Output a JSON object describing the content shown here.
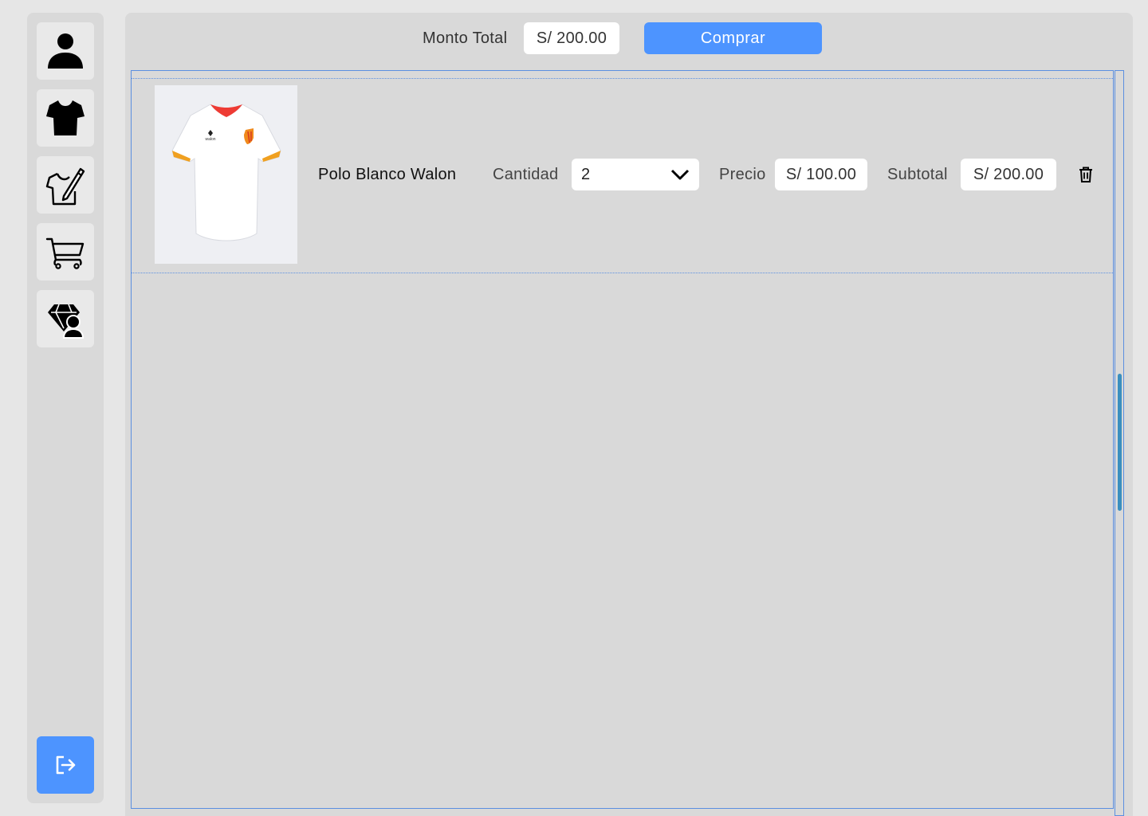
{
  "sidebar": {
    "items": [
      {
        "name": "profile",
        "icon": "user-icon"
      },
      {
        "name": "products",
        "icon": "tshirt-icon"
      },
      {
        "name": "design",
        "icon": "tshirt-pencil-icon"
      },
      {
        "name": "cart",
        "icon": "cart-icon"
      },
      {
        "name": "brand",
        "icon": "gem-user-icon"
      }
    ],
    "logout_icon": "logout-icon"
  },
  "cart": {
    "total_label": "Monto Total",
    "total_value": "S/ 200.00",
    "buy_label": "Comprar",
    "items": [
      {
        "name": "Polo Blanco Walon",
        "quantity_label": "Cantidad",
        "quantity": "2",
        "price_label": "Precio",
        "price": "S/ 100.00",
        "subtotal_label": "Subtotal",
        "subtotal": "S/ 200.00",
        "image_logo_text": "walon"
      }
    ]
  },
  "colors": {
    "accent": "#4d94ff",
    "panel": "#d9d9d9",
    "background": "#e6e6e6"
  }
}
